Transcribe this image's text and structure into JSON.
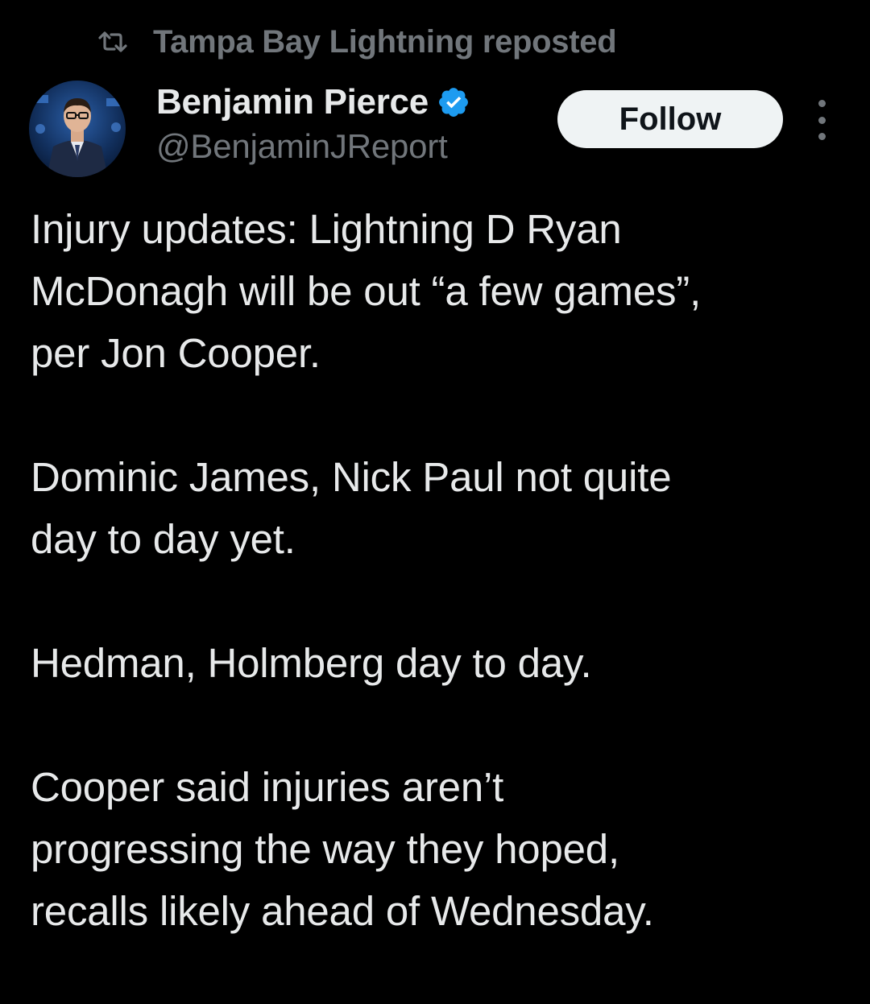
{
  "repost": {
    "icon": "repost-icon",
    "text": "Tampa Bay Lightning reposted"
  },
  "author": {
    "display_name": "Benjamin Pierce",
    "handle": "@BenjaminJReport",
    "verified_icon": "verified-badge-icon",
    "verified_color": "#1d9bf0"
  },
  "actions": {
    "follow_label": "Follow",
    "more_icon": "more-vertical-icon"
  },
  "post": {
    "paragraphs": [
      {
        "lines": [
          "Injury updates: Lightning D Ryan",
          "McDonagh will be out “a few games”,",
          "per Jon Cooper."
        ]
      },
      {
        "lines": [
          "Dominic James, Nick Paul not quite",
          "day to day yet."
        ]
      },
      {
        "lines": [
          "Hedman, Holmberg day to day."
        ]
      },
      {
        "lines": [
          "Cooper said injuries aren’t",
          "progressing the way they hoped,",
          "recalls likely ahead of Wednesday."
        ]
      }
    ]
  },
  "colors": {
    "background": "#000000",
    "text_primary": "#e7e9ea",
    "text_secondary": "#71767b",
    "follow_bg": "#eff3f4"
  }
}
